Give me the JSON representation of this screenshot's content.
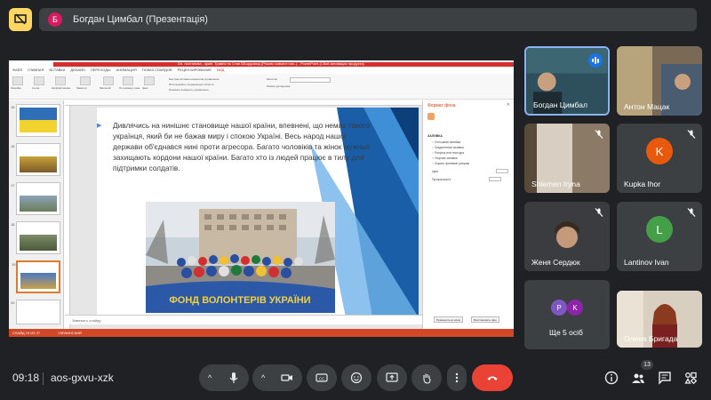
{
  "presenter": {
    "avatar_letter": "Б",
    "label": "Богдан Цимбал (Презентація)",
    "avatar_color": "#d81b60"
  },
  "ppt": {
    "title": "Dл. постанова - ajмін. Травня по Cтан.ББордовиці [Режим совмест.поп..] - PowerPoint (Сбой активации продукта)",
    "tabs": [
      "ФАЙЛ",
      "ГЛАВНАЯ",
      "ВСТАВКА",
      "ДИЗАЙН",
      "ПЕРЕХОДЫ",
      "АНИМАЦИЯ",
      "ПОКАЗ СЛАЙДОВ",
      "РЕЦЕНЗИРОВАНИЕ",
      "ВИД"
    ],
    "ribbon": {
      "buttons": [
        "Линейка",
        "Сетка",
        "Направляющие",
        "Заметки",
        "Масштаб",
        "По размеру окна",
        "Цвет",
        "Оттенки серого",
        "Черно-белый",
        "Новое окно",
        "Упорядочить все"
      ],
      "checks": [
        "Быстрая вставка элементов управления",
        "Использовать сохраненную область",
        "Показать элементы управления"
      ],
      "select_label": "Монитор",
      "select_value": "Автоматически",
      "check_right": "Режим докладчика"
    },
    "slide_numbers": [
      "15",
      "16",
      "17",
      "18",
      "19",
      "20"
    ],
    "slide_text": "Дивлячись на нинішнє становище нашої країни, впевнені, що немає такого українця, який би не бажав миру і спокою Україні. Весь народ нашої держави об'єднався нині проти агресора. Багато чоловіків та жінок мужньо захищають кордони нашої країни. Багато хто із людей працює в тилу для підтримки солдатів.",
    "banner_text": "ФОНД ВОЛОНТЕРІВ УКРАЇНИ",
    "notes": "Заметки к слайду",
    "format_pane": {
      "title": "Формат фона",
      "section": "ЗАЛИВКА",
      "options": [
        "Сплошная заливка",
        "Градиентная заливка",
        "Рисунок или текстура",
        "Узорная заливка",
        "Скрыть фоновые рисунки"
      ],
      "color_label": "Цвет",
      "transparency_label": "Прозрачность",
      "transparency_value": "0%",
      "btn_apply_all": "Применить ко всем",
      "btn_reset": "Восстановить фон"
    },
    "status_left": "СЛАЙД 19 ИЗ 27",
    "status_lang": "УКРАИНСКИЙ"
  },
  "participants": [
    {
      "name": "Богдан Цимбал",
      "type": "video",
      "speaking": true
    },
    {
      "name": "Антон Мацак",
      "type": "video"
    },
    {
      "name": "Shlemen Iryna",
      "type": "video",
      "muted": true
    },
    {
      "name": "Kupka Ihor",
      "type": "avatar",
      "letter": "K",
      "color": "#e8590c",
      "muted": true
    },
    {
      "name": "Женя Сердюк",
      "type": "video",
      "muted": true
    },
    {
      "name": "Lantinov Ivan",
      "type": "avatar",
      "letter": "L",
      "color": "#43a047",
      "muted": true
    },
    {
      "name": "Ще 5 осіб",
      "type": "group",
      "letters": [
        "P",
        "K"
      ],
      "colors": [
        "#7e57c2",
        "#8e24aa"
      ]
    },
    {
      "name": "Олена Бригада",
      "type": "video"
    }
  ],
  "bottom": {
    "time": "09:18",
    "meeting_code": "aos-gxvu-xzk",
    "participant_count": "13"
  },
  "colors": {
    "end_call": "#ea4335",
    "accent": "#1a73e8",
    "present": "#fdd663"
  }
}
